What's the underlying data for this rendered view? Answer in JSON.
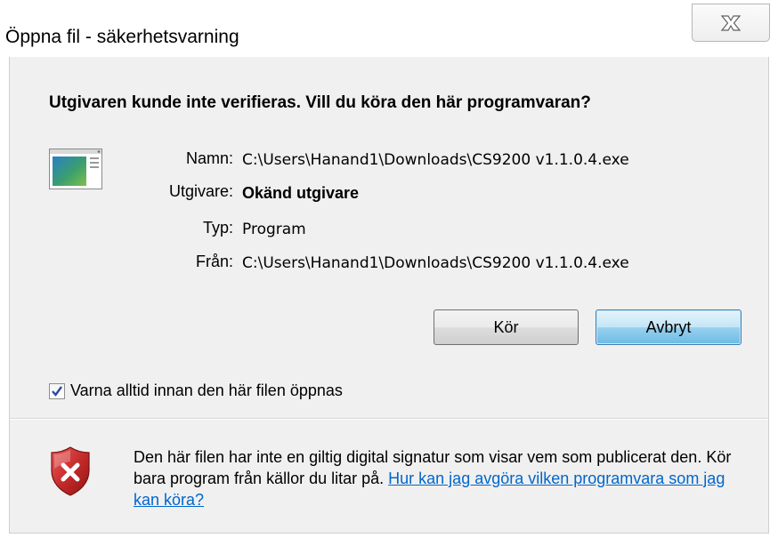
{
  "window": {
    "title": "Öppna fil - säkerhetsvarning",
    "close_label": "Stäng"
  },
  "dialog": {
    "heading": "Utgivaren kunde inte verifieras. Vill du köra den här programvaran?",
    "fields": [
      {
        "label": "Namn:",
        "value": "C:\\Users\\Hanand1\\Downloads\\CS9200 v1.1.0.4.exe"
      },
      {
        "label": "Utgivare:",
        "value": "Okänd utgivare"
      },
      {
        "label": "Typ:",
        "value": "Program"
      },
      {
        "label": "Från:",
        "value": "C:\\Users\\Hanand1\\Downloads\\CS9200 v1.1.0.4.exe"
      }
    ],
    "run_button": "Kör",
    "cancel_button": "Avbryt",
    "checkbox_label": "Varna alltid innan den här filen öppnas",
    "checkbox_checked": true
  },
  "footer": {
    "text": "Den här filen har inte en giltig digital signatur som visar vem som publicerat den. Kör bara program från källor du litar på.",
    "link": "Hur kan jag avgöra vilken programvara som jag kan köra?"
  },
  "colors": {
    "link": "#0066cc",
    "shield": "#c62b2b",
    "dialog_bg": "#f0f0f0"
  }
}
